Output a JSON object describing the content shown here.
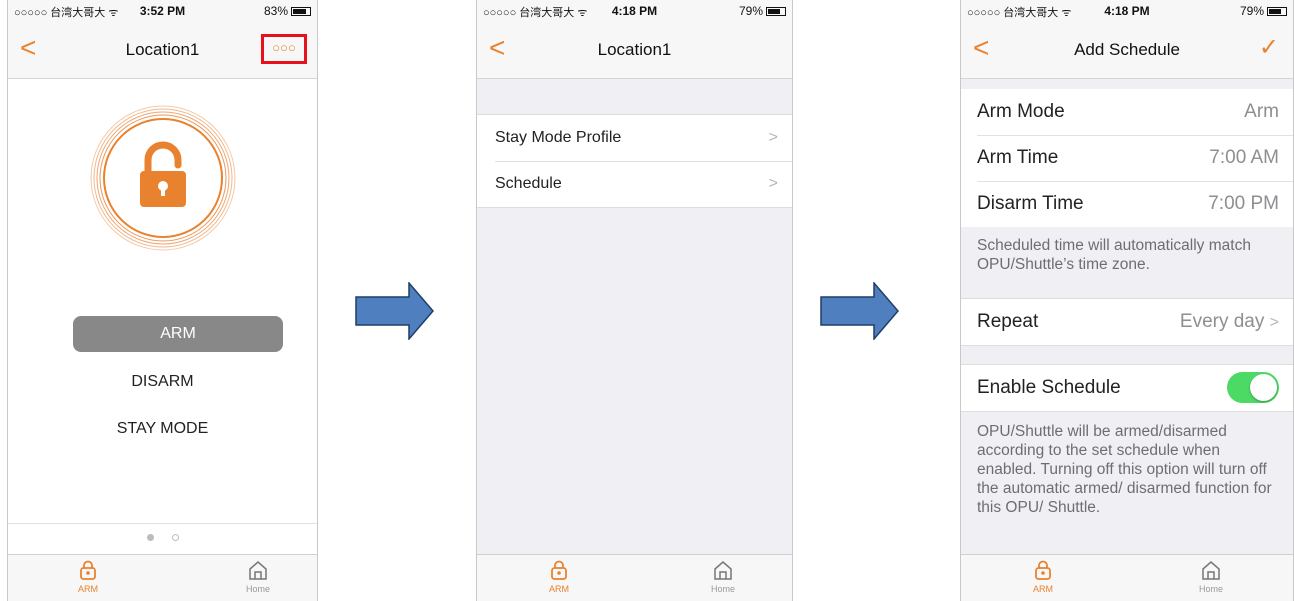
{
  "status": {
    "carrier": "○○○○○ 台湾大哥大 ᯤ",
    "screen1_time": "3:52 PM",
    "screen1_battery": "83%",
    "screen2_time": "4:18 PM",
    "screen2_battery": "79%",
    "screen3_time": "4:18 PM",
    "screen3_battery": "79%"
  },
  "screen1": {
    "nav_title": "Location1",
    "more_label": "○○○",
    "modes": [
      "ARM",
      "DISARM",
      "STAY MODE"
    ],
    "selected_mode": "ARM"
  },
  "screen2": {
    "nav_title": "Location1",
    "items": [
      "Stay Mode Profile",
      "Schedule"
    ]
  },
  "screen3": {
    "nav_title": "Add Schedule",
    "rows": [
      {
        "label": "Arm Mode",
        "value": "Arm"
      },
      {
        "label": "Arm Time",
        "value": "7:00 AM"
      },
      {
        "label": "Disarm Time",
        "value": "7:00 PM"
      }
    ],
    "timezone_note": "Scheduled time will automatically match OPU/Shuttle’s time zone.",
    "repeat_label": "Repeat",
    "repeat_value": "Every day",
    "enable_label": "Enable Schedule",
    "enable_on": true,
    "enable_note": "OPU/Shuttle will be armed/disarmed according to the set schedule when enabled. Turning off this option will turn off the automatic armed/ disarmed function for this OPU/ Shuttle."
  },
  "tabbar": {
    "arm_label": "ARM",
    "home_label": "Home"
  },
  "colors": {
    "accent": "#e8822e",
    "arrow_fill": "#4f7fbf",
    "toggle_on": "#4cd964",
    "highlight_box": "#e8101a"
  },
  "icons": [
    "back-chevron-icon",
    "more-icon",
    "lock-icon",
    "home-icon",
    "chevron-right-icon",
    "checkmark-icon",
    "wifi-icon",
    "battery-icon"
  ]
}
